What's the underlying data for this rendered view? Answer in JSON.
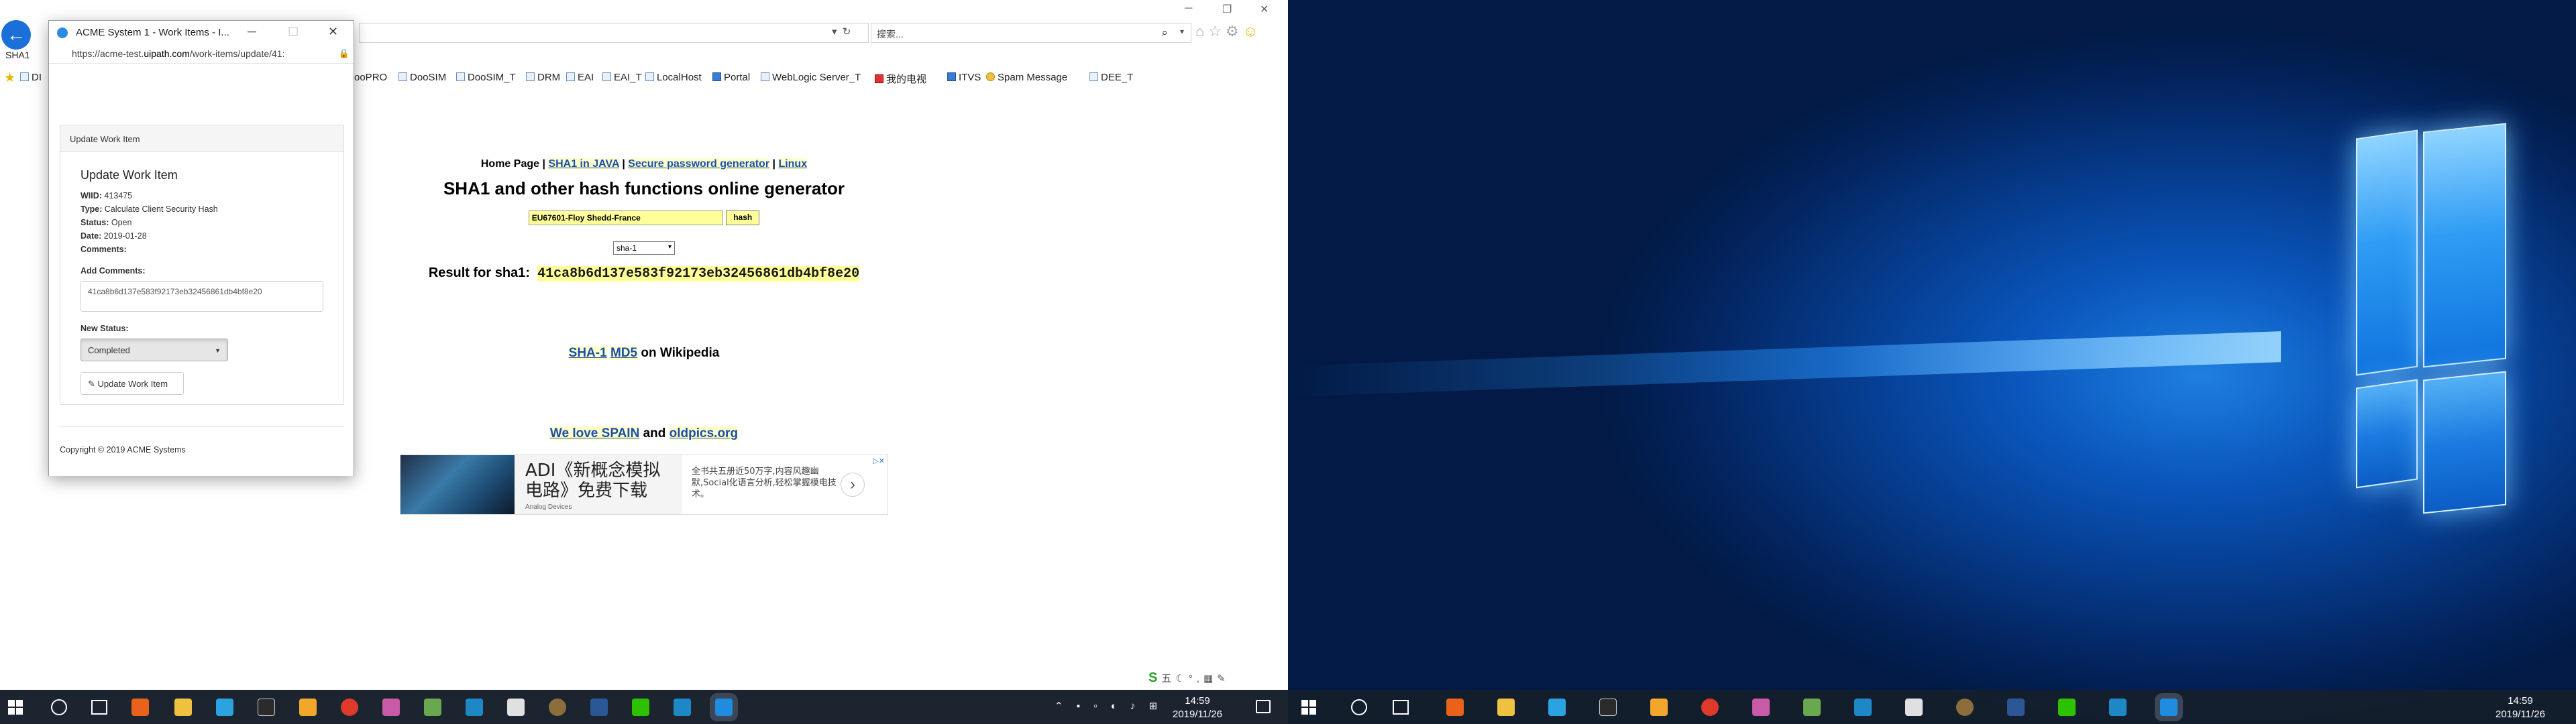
{
  "browser": {
    "url_bar": "",
    "search_placeholder": "搜索...",
    "tab_label": "SHA1",
    "favorites": [
      "DI",
      "ooPRO",
      "DooSIM",
      "DooSIM_T",
      "DRM",
      "EAI",
      "EAI_T",
      "LocalHost",
      "Portal",
      "WebLogic Server_T",
      "我的电视",
      "ITVS",
      "Spam Message",
      "DEE_T"
    ]
  },
  "page": {
    "nav": {
      "home": "Home Page",
      "sep": "|",
      "sha1_java": "SHA1 in JAVA",
      "secure_pw": "Secure password generator",
      "linux": "Linux"
    },
    "title": "SHA1 and other hash functions online generator",
    "input_value": "EU67601-Floy Shedd-France",
    "hash_button": "hash",
    "algorithm": "sha-1",
    "result_label": "Result for sha1:",
    "result_hash": "41ca8b6d137e583f92173eb32456861db4bf8e20",
    "wiki": {
      "sha1": "SHA-1",
      "md5": "MD5",
      "suffix": "on Wikipedia"
    },
    "spain": {
      "link1": "We love SPAIN",
      "and": "and",
      "link2": "oldpics.org"
    },
    "ad": {
      "title_line1": "ADI《新概念模拟",
      "title_line2": "电路》免费下载",
      "sponsor": "Analog Devices",
      "text": "全书共五册近50万字,内容风趣幽默,Social化语言分析,轻松掌握模电技术。"
    }
  },
  "popup": {
    "window_title": "ACME System 1 - Work Items - I...",
    "url_prefix": "https://acme-test.",
    "url_domain": "uipath.com",
    "url_suffix": "/work-items/update/41:",
    "panel_heading": "Update Work Item",
    "form_title": "Update Work Item",
    "wiid_label": "WIID:",
    "wiid": "413475",
    "type_label": "Type:",
    "type": "Calculate Client Security Hash",
    "status_label": "Status:",
    "status": "Open",
    "date_label": "Date:",
    "date": "2019-01-28",
    "comments_label": "Comments:",
    "add_comments_label": "Add Comments:",
    "add_comments_value": "41ca8b6d137e583f92173eb32456861db4bf8e20",
    "new_status_label": "New Status:",
    "new_status_value": "Completed",
    "update_button": "Update Work Item",
    "footer": "Copyright © 2019 ACME Systems"
  },
  "taskbar_left": {
    "time": "14:59",
    "date": "2019/11/26"
  },
  "taskbar_right": {
    "time": "14:59",
    "date": "2019/11/26"
  }
}
